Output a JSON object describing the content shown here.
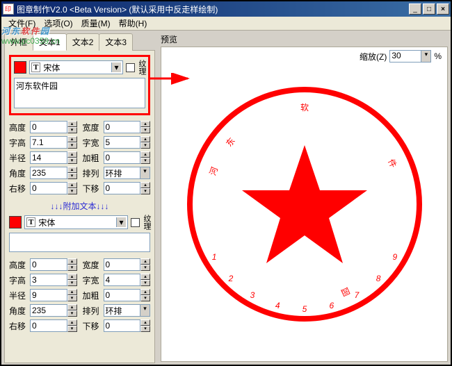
{
  "window": {
    "title": "图章制作V2.0 <Beta Version>  (默认采用中反走样绘制)"
  },
  "menu": {
    "file": "文件(F)",
    "options": "选项(O)",
    "quality": "质量(M)",
    "help": "帮助(H)"
  },
  "tabs": {
    "border": "外框",
    "text1": "文本1",
    "text2": "文本2",
    "text3": "文本3"
  },
  "block1": {
    "font": "宋体",
    "texture": "纹理",
    "text": "河东软件园",
    "height_lbl": "高度",
    "height": "0",
    "width_lbl": "宽度",
    "width": "0",
    "fontH_lbl": "字高",
    "fontH": "7.1",
    "fontW_lbl": "字宽",
    "fontW": "5",
    "radius_lbl": "半径",
    "radius": "14",
    "bold_lbl": "加粗",
    "bold": "0",
    "angle_lbl": "角度",
    "angle": "235",
    "arrange_lbl": "排列",
    "arrange": "环排",
    "offx_lbl": "右移",
    "offx": "0",
    "offy_lbl": "下移",
    "offy": "0"
  },
  "attachHead": "↓↓↓附加文本↓↓↓",
  "block2": {
    "font": "宋体",
    "texture": "纹理",
    "text": "",
    "height_lbl": "高度",
    "height": "0",
    "width_lbl": "宽度",
    "width": "0",
    "fontH_lbl": "字高",
    "fontH": "3",
    "fontW_lbl": "字宽",
    "fontW": "4",
    "radius_lbl": "半径",
    "radius": "9",
    "bold_lbl": "加粗",
    "bold": "0",
    "angle_lbl": "角度",
    "angle": "235",
    "arrange_lbl": "排列",
    "arrange": "环排",
    "offx_lbl": "右移",
    "offx": "0",
    "offy_lbl": "下移",
    "offy": "0"
  },
  "preview": {
    "label": "预览",
    "zoom_lbl": "缩放(Z)",
    "zoom": "30",
    "pct": "%"
  },
  "seal": {
    "ring_text": [
      "东",
      "软",
      "件",
      "园",
      "河"
    ],
    "numbers": [
      "1",
      "2",
      "3",
      "4",
      "5",
      "6",
      "7",
      "8",
      "9"
    ]
  },
  "watermark": {
    "brand_pre": "河东",
    "brand_mid": "软件",
    "brand_post": "园",
    "url": "www.pc0359.cn"
  }
}
